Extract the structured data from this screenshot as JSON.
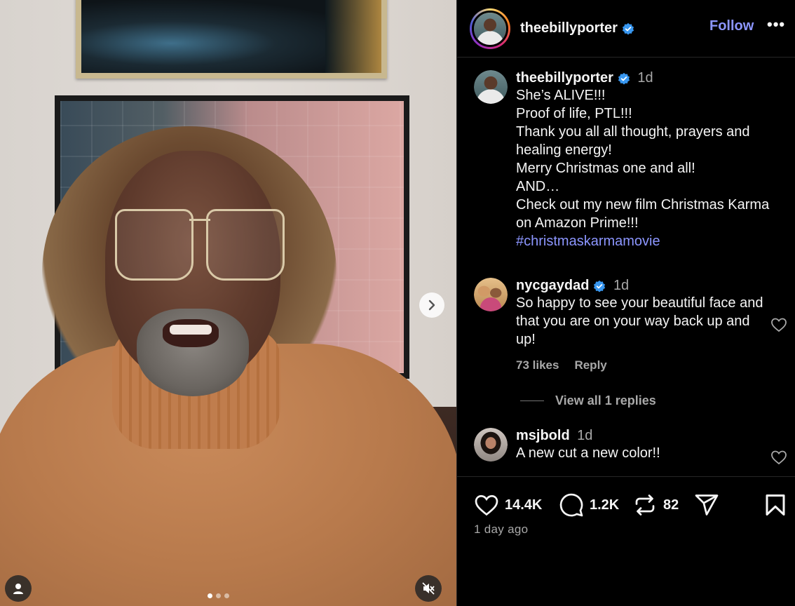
{
  "post": {
    "author": "theebillyporter",
    "follow_label": "Follow",
    "more_label": "•••",
    "caption": {
      "time": "1d",
      "lines": "She’s ALIVE!!!\nProof of life, PTL!!!\nThank you all all thought, prayers and healing energy!\nMerry Christmas one and all!\nAND…\nCheck out my new film Christmas Karma on Amazon Prime!!!",
      "hashtag": "#christmaskarmamovie"
    },
    "comments": [
      {
        "user": "nycgaydad",
        "verified": true,
        "time": "1d",
        "text": "So happy to see your beautiful face and that you are on your way back up and up!",
        "likes": "73 likes",
        "reply_label": "Reply",
        "view_replies": "View all 1 replies"
      },
      {
        "user": "msjbold",
        "verified": false,
        "time": "1d",
        "text": "A new cut a new color!!"
      }
    ],
    "stats": {
      "likes": "14.4K",
      "comments": "1.2K",
      "reposts": "82"
    },
    "posted_ago": "1 day ago",
    "carousel": {
      "count": 3,
      "active_index": 0
    }
  },
  "colors": {
    "accent_link": "#8c96ff",
    "verified_badge": "#3897f0",
    "background": "#000000",
    "muted_text": "#a8a8a8"
  },
  "icons": [
    "verified-icon",
    "heart-icon",
    "comment-icon",
    "repost-icon",
    "share-icon",
    "bookmark-icon",
    "chevron-right-icon",
    "user-tag-icon",
    "muted-speaker-icon"
  ]
}
